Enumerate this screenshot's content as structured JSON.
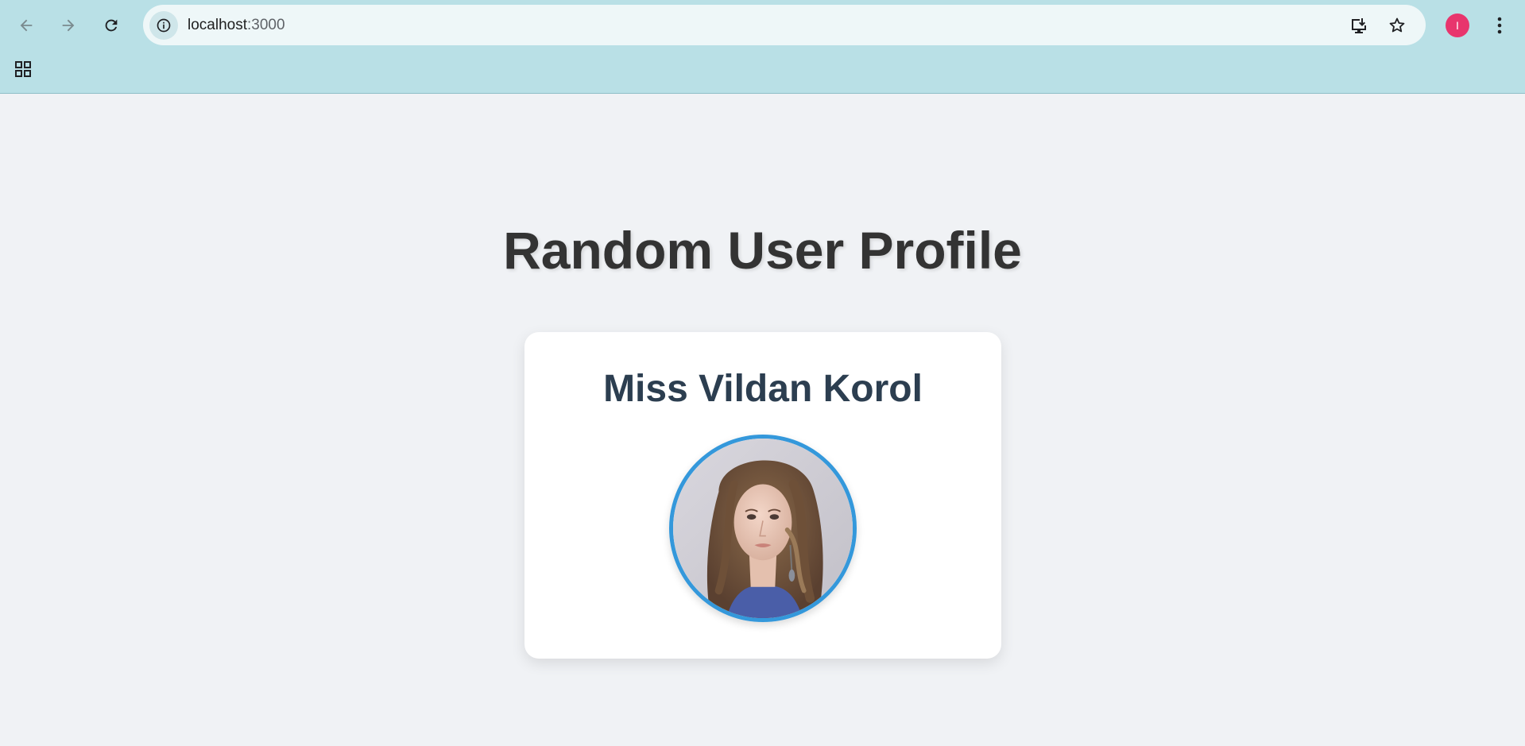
{
  "browser": {
    "url_host": "localhost",
    "url_port": ":3000",
    "profile_initial": "I",
    "colors": {
      "chrome_background": "#b9e0e6",
      "omnibox_background": "#eef7f8",
      "profile_avatar": "#e8356d"
    },
    "icons": {
      "back": "arrow-left-icon",
      "forward": "arrow-right-icon",
      "reload": "reload-icon",
      "site_info": "info-icon",
      "install": "install-app-icon",
      "bookmark": "star-icon",
      "menu": "kebab-menu-icon",
      "apps": "apps-grid-icon"
    }
  },
  "page": {
    "title": "Random User Profile",
    "colors": {
      "background": "#f0f2f5",
      "title": "#333333",
      "name": "#2c3e50",
      "avatar_border": "#3498db",
      "card": "#ffffff"
    }
  },
  "profile": {
    "name": "Miss Vildan Korol",
    "photo": "user-portrait"
  }
}
